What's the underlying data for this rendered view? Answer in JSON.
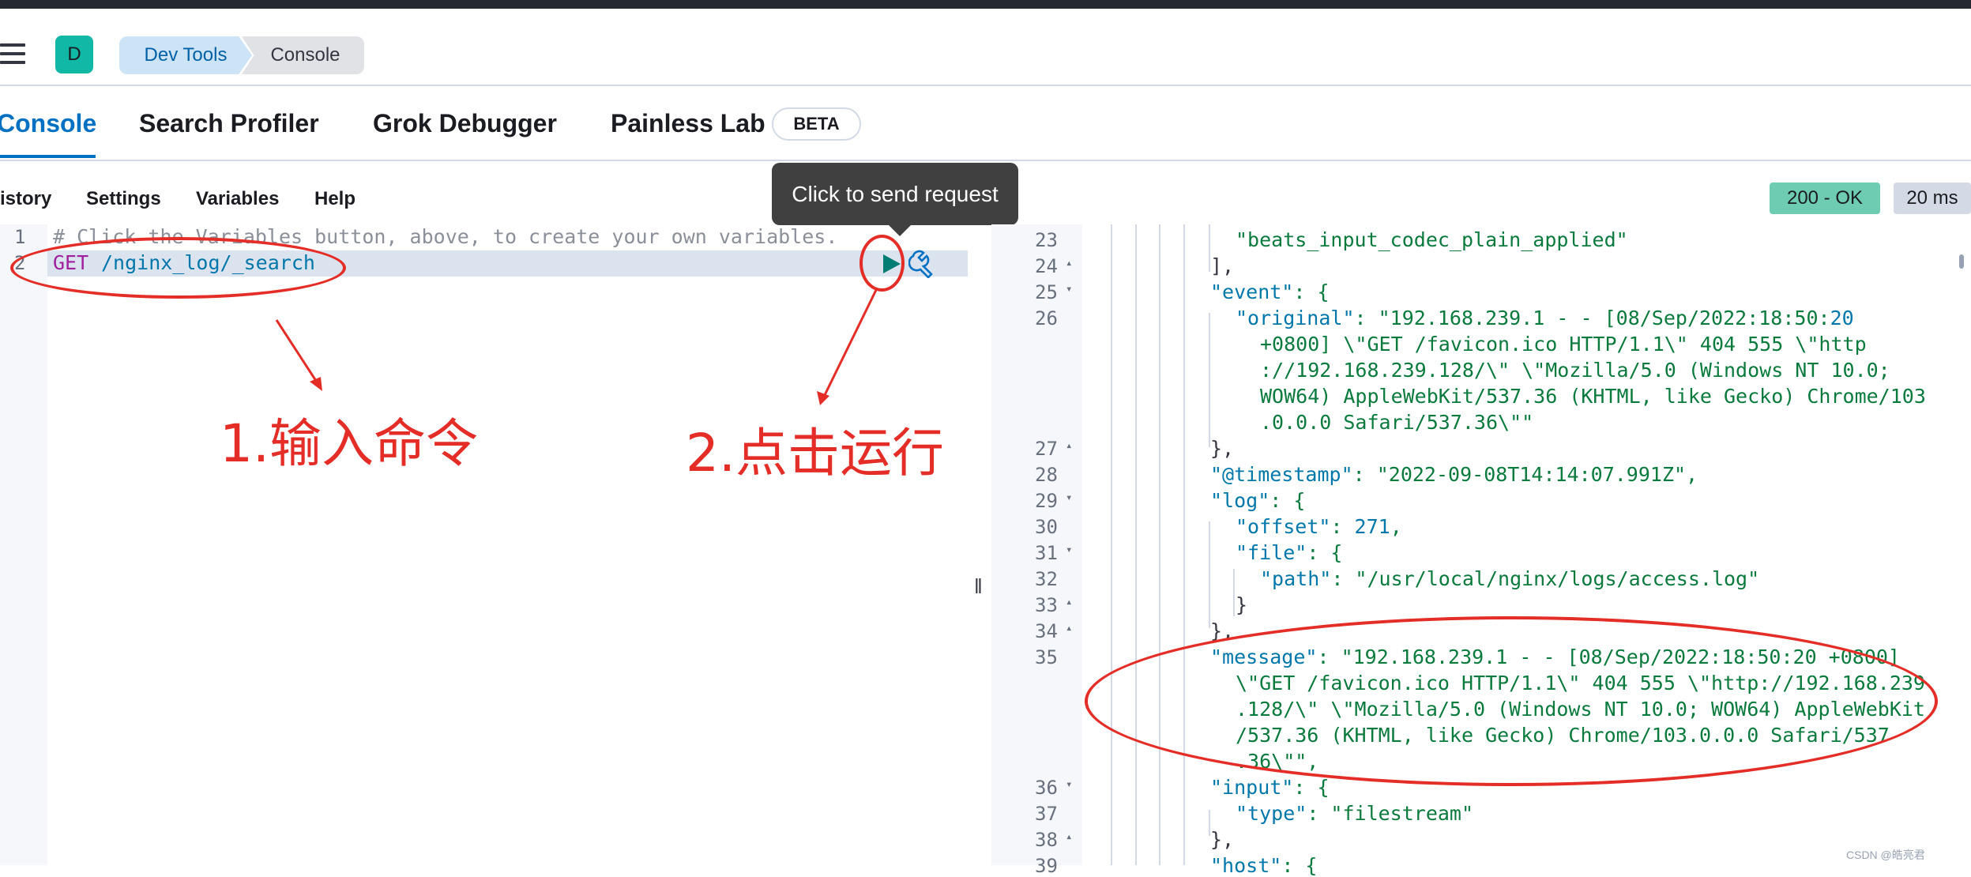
{
  "header": {
    "avatar_letter": "D",
    "breadcrumbs": [
      "Dev Tools",
      "Console"
    ]
  },
  "tabs": [
    {
      "label": "Console",
      "active": true
    },
    {
      "label": "Search Profiler"
    },
    {
      "label": "Grok Debugger"
    },
    {
      "label": "Painless Lab"
    }
  ],
  "beta_badge": "BETA",
  "toolbar": {
    "items": [
      "istory",
      "Settings",
      "Variables",
      "Help"
    ]
  },
  "tooltip": "Click to send request",
  "response": {
    "status": "200 - OK",
    "time": "20 ms"
  },
  "editor": {
    "line_numbers": [
      "1",
      "2"
    ],
    "comment": "# Click the Variables button, above, to create your own variables.",
    "method": "GET",
    "path": "/nginx_log/_search"
  },
  "output": {
    "line_numbers": [
      "23",
      "24",
      "25",
      "26",
      "",
      "",
      "",
      "",
      "27",
      "28",
      "29",
      "30",
      "31",
      "32",
      "33",
      "34",
      "35",
      "",
      "",
      "",
      "",
      "36",
      "37",
      "38",
      "39"
    ],
    "lines": [
      "\"beats_input_codec_plain_applied\"",
      "],",
      "\"event\": {",
      "\"original\": \"192.168.239.1 - - [08/Sep/2022:18:50:20",
      "+0800] \\\"GET /favicon.ico HTTP/1.1\\\" 404 555 \\\"http",
      "://192.168.239.128/\\\" \\\"Mozilla/5.0 (Windows NT 10.0;",
      "WOW64) AppleWebKit/537.36 (KHTML, like Gecko) Chrome/103",
      ".0.0.0 Safari/537.36\\\"\"",
      "},",
      "\"@timestamp\": \"2022-09-08T14:14:07.991Z\",",
      "\"log\": {",
      "\"offset\": 271,",
      "\"file\": {",
      "\"path\": \"/usr/local/nginx/logs/access.log\"",
      "}",
      "},",
      "\"message\": \"192.168.239.1 - - [08/Sep/2022:18:50:20 +0800]",
      "\\\"GET /favicon.ico HTTP/1.1\\\" 404 555 \\\"http://192.168.239",
      ".128/\\\" \\\"Mozilla/5.0 (Windows NT 10.0; WOW64) AppleWebKit",
      "/537.36 (KHTML, like Gecko) Chrome/103.0.0.0 Safari/537",
      ".36\\\"\",",
      "\"input\": {",
      "\"type\": \"filestream\"",
      "},",
      "\"host\": {"
    ]
  },
  "annotations": {
    "step1": "1.输入命令",
    "step2": "2.点击运行"
  },
  "colors": {
    "accent": "#0071c2",
    "annotation": "#e52d27",
    "ok": "#6dccb1"
  },
  "watermark": "CSDN @皓亮君"
}
